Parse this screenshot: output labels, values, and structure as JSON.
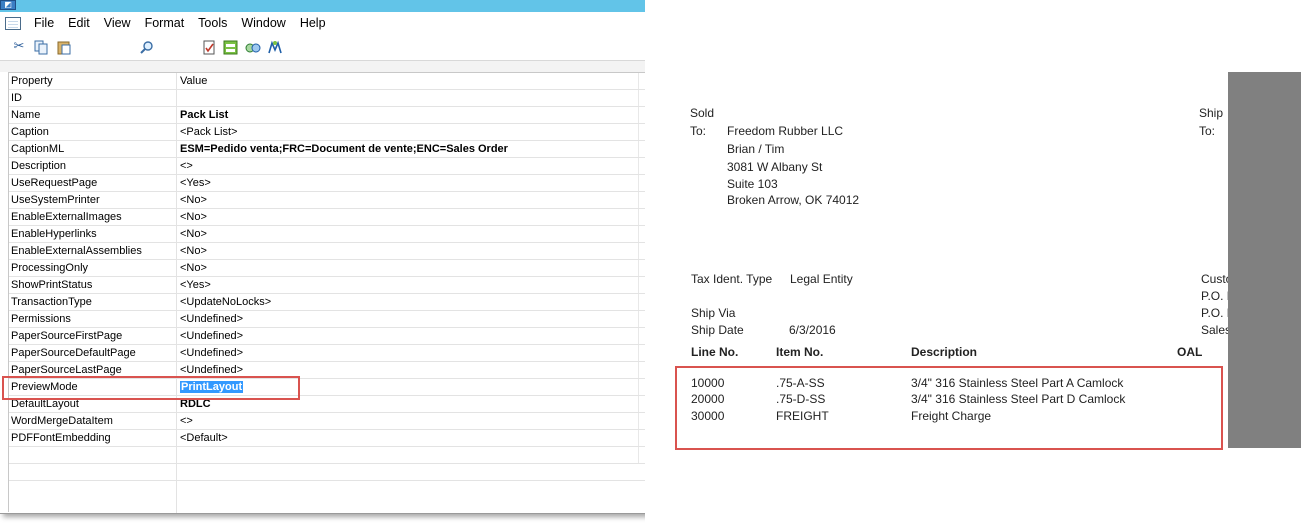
{
  "menu": {
    "items": [
      "File",
      "Edit",
      "View",
      "Format",
      "Tools",
      "Window",
      "Help"
    ]
  },
  "toolbar": {
    "icons": [
      "cut-icon",
      "copy-icon",
      "paste-icon",
      "find-icon",
      "properties-icon",
      "design-icon",
      "link-icon",
      "connect-icon"
    ]
  },
  "grid": {
    "header": {
      "property": "Property",
      "value": "Value"
    },
    "rows": [
      {
        "property": "ID",
        "value": ""
      },
      {
        "property": "Name",
        "value": "Pack List",
        "bold": true
      },
      {
        "property": "Caption",
        "value": "<Pack List>"
      },
      {
        "property": "CaptionML",
        "value": "ESM=Pedido venta;FRC=Document de vente;ENC=Sales Order",
        "bold": true
      },
      {
        "property": "Description",
        "value": "<>"
      },
      {
        "property": "UseRequestPage",
        "value": "<Yes>"
      },
      {
        "property": "UseSystemPrinter",
        "value": "<No>"
      },
      {
        "property": "EnableExternalImages",
        "value": "<No>"
      },
      {
        "property": "EnableHyperlinks",
        "value": "<No>"
      },
      {
        "property": "EnableExternalAssemblies",
        "value": "<No>"
      },
      {
        "property": "ProcessingOnly",
        "value": "<No>"
      },
      {
        "property": "ShowPrintStatus",
        "value": "<Yes>"
      },
      {
        "property": "TransactionType",
        "value": "<UpdateNoLocks>"
      },
      {
        "property": "Permissions",
        "value": "<Undefined>"
      },
      {
        "property": "PaperSourceFirstPage",
        "value": "<Undefined>"
      },
      {
        "property": "PaperSourceDefaultPage",
        "value": "<Undefined>"
      },
      {
        "property": "PaperSourceLastPage",
        "value": "<Undefined>"
      },
      {
        "property": "PreviewMode",
        "value": "PrintLayout",
        "selected": true
      },
      {
        "property": "DefaultLayout",
        "value": "RDLC",
        "bold": true
      },
      {
        "property": "WordMergeDataItem",
        "value": "<>"
      },
      {
        "property": "PDFFontEmbedding",
        "value": "<Default>"
      }
    ]
  },
  "report": {
    "sold_label": "Sold",
    "to_label": "To:",
    "ship_label": "Ship",
    "ship_to_label": "To:",
    "address": [
      "Freedom Rubber LLC",
      "Brian / Tim",
      "3081 W Albany St",
      "Suite 103",
      "Broken Arrow, OK  74012"
    ],
    "tax_ident_label": "Tax Ident. Type",
    "tax_ident_value": "Legal Entity",
    "cust_label": "Custo",
    "po_no_label": "P.O. N",
    "po_date_label": "P.O. D",
    "sales_label": "Sales",
    "ship_via_label": "Ship Via",
    "ship_date_label": "Ship Date",
    "ship_date_value": "6/3/2016",
    "columns": {
      "line_no": "Line No.",
      "item_no": "Item No.",
      "description": "Description",
      "qty": "OAL"
    },
    "lines": [
      {
        "line_no": "10000",
        "item_no": ".75-A-SS",
        "description": "3/4\" 316 Stainless Steel Part A Camlock"
      },
      {
        "line_no": "20000",
        "item_no": ".75-D-SS",
        "description": "3/4\" 316 Stainless Steel Part D Camlock"
      },
      {
        "line_no": "30000",
        "item_no": "FREIGHT",
        "description": "Freight Charge"
      }
    ]
  },
  "colors": {
    "titlebar": "#62c4e8",
    "selection": "#3399ff",
    "highlight_box": "#d9534f",
    "gray_panel": "#808080"
  }
}
